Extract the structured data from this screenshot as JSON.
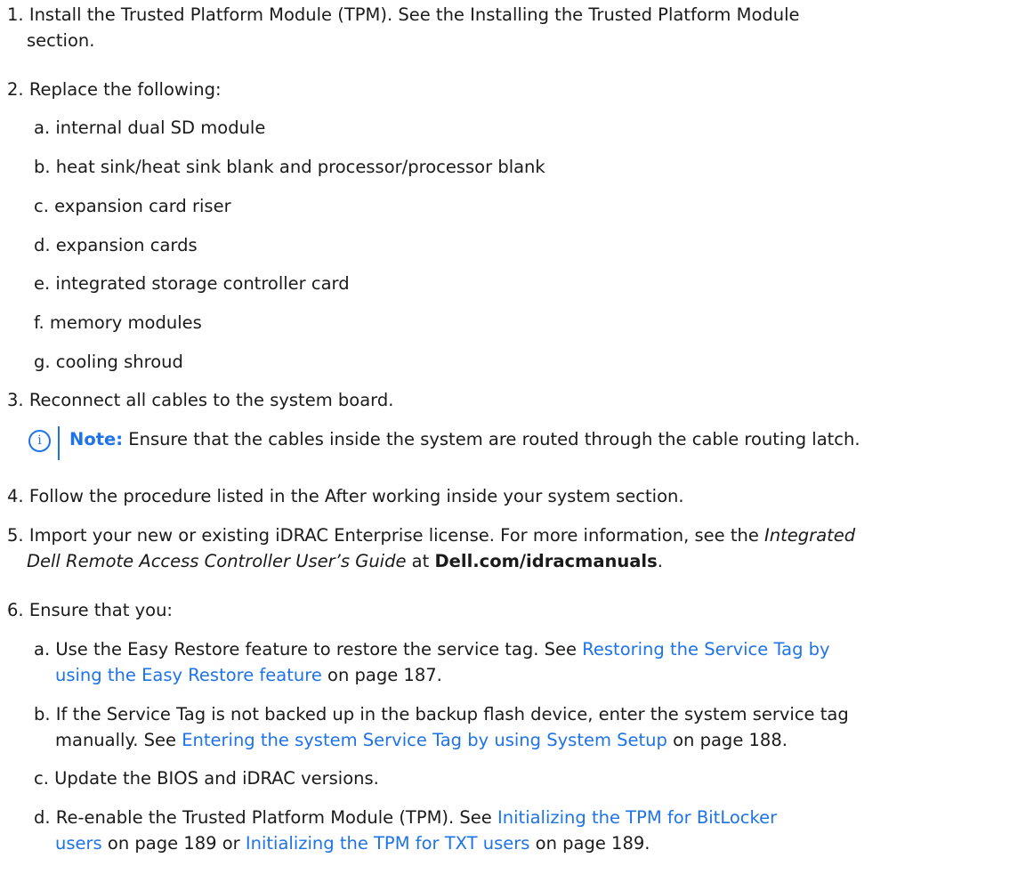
{
  "steps": [
    {
      "num": "1.",
      "line1": "Install the Trusted Platform Module (TPM). See the Installing the Trusted Platform Module",
      "line2": "section."
    },
    {
      "num": "2.",
      "text": "Replace the following:",
      "items": [
        {
          "letter": "a.",
          "text": "internal dual SD module"
        },
        {
          "letter": "b.",
          "text": "heat sink/heat sink blank and processor/processor blank"
        },
        {
          "letter": "c.",
          "text": "expansion card riser"
        },
        {
          "letter": "d.",
          "text": "expansion cards"
        },
        {
          "letter": "e.",
          "text": "integrated storage controller card"
        },
        {
          "letter": "f.",
          "text": "memory modules"
        },
        {
          "letter": "g.",
          "text": "cooling shroud"
        }
      ]
    },
    {
      "num": "3.",
      "text": "Reconnect all cables to the system board.",
      "note": {
        "icon": "i",
        "label": "Note:",
        "text": " Ensure that the cables inside the system are routed through the cable routing latch."
      }
    },
    {
      "num": "4.",
      "text": "Follow the procedure listed in the After working inside your system section."
    },
    {
      "num": "5.",
      "line1_pre": "Import your new or existing iDRAC Enterprise license. For more information, see the ",
      "line1_em": "Integrated",
      "line2_em": "Dell Remote Access Controller User’s Guide",
      "line2_mid": " at ",
      "line2_bold": "Dell.com/idracmanuals",
      "line2_post": "."
    },
    {
      "num": "6.",
      "text": "Ensure that you:",
      "items": [
        {
          "letter": "a.",
          "line1_pre": "Use the Easy Restore feature to restore the service tag. See ",
          "line1_link": "Restoring the Service Tag by",
          "line2_link": "using the Easy Restore feature",
          "line2_post": " on page 187."
        },
        {
          "letter": "b.",
          "line1": "If the Service Tag is not backed up in the backup flash device, enter the system service tag",
          "line2_pre": "manually. See ",
          "line2_link": "Entering the system Service Tag by using System Setup",
          "line2_post": " on page 188."
        },
        {
          "letter": "c.",
          "text": "Update the BIOS and iDRAC versions."
        },
        {
          "letter": "d.",
          "line1_pre": "Re-enable the Trusted Platform Module (TPM). See ",
          "line1_link": "Initializing the TPM for BitLocker",
          "line2_link": "users",
          "line2_mid": " on page 189 or ",
          "line2_link2": "Initializing the TPM for TXT users",
          "line2_post": " on page 189."
        }
      ]
    }
  ]
}
